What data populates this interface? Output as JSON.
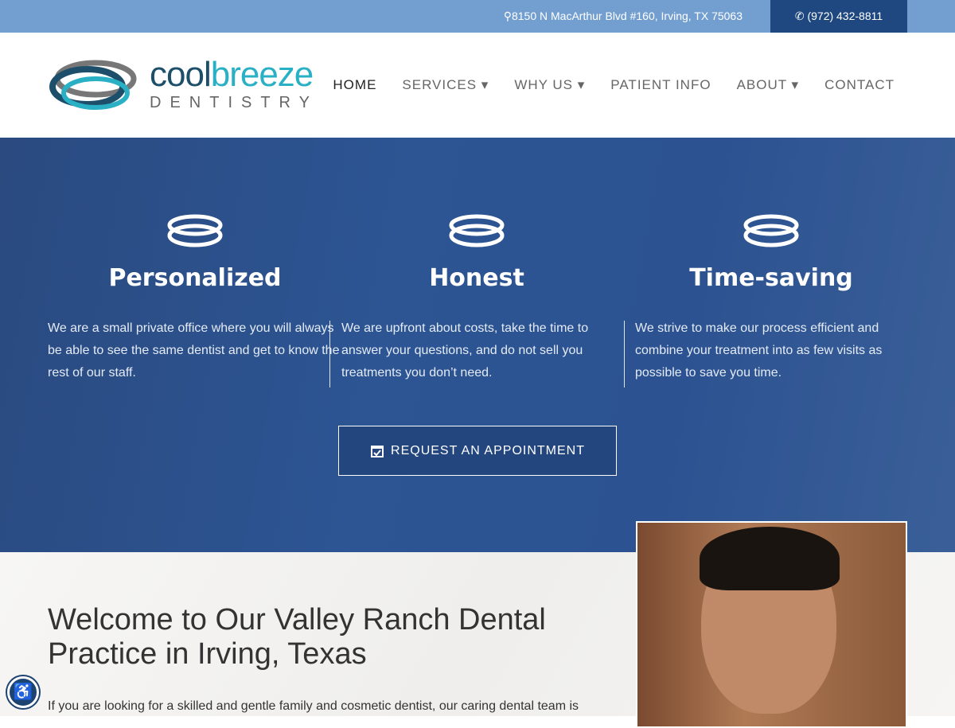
{
  "topbar": {
    "address": "8150 N MacArthur Blvd #160, Irving, TX 75063",
    "phone": "(972) 432-8811"
  },
  "logo": {
    "word1": "cool",
    "word2": "breeze",
    "word3": "DENTISTRY"
  },
  "nav": [
    {
      "label": "HOME"
    },
    {
      "label": "SERVICES ▾"
    },
    {
      "label": "WHY US ▾"
    },
    {
      "label": "PATIENT INFO"
    },
    {
      "label": "ABOUT ▾"
    },
    {
      "label": "CONTACT"
    }
  ],
  "features": [
    {
      "title": "Personalized",
      "text": "We are a small private office where you will always be able to see the same dentist and get to know the rest of our staff."
    },
    {
      "title": "Honest",
      "text": "We are upfront about costs, take the time to answer your questions, and do not sell you treatments you don’t need."
    },
    {
      "title": "Time-saving",
      "text": "We strive to make our process efficient and combine your treatment into as few visits as possible to save you time."
    }
  ],
  "cta": {
    "label": "REQUEST AN APPOINTMENT"
  },
  "welcome": {
    "title": "Welcome to Our Valley Ranch Dental Practice in Irving, Texas",
    "intro": "If you are looking for a skilled and gentle family and cosmetic dentist, our caring dental team is"
  },
  "colors": {
    "topbar": "#739fd0",
    "phone_bg": "#1f4780",
    "hero": "#2d5593"
  }
}
